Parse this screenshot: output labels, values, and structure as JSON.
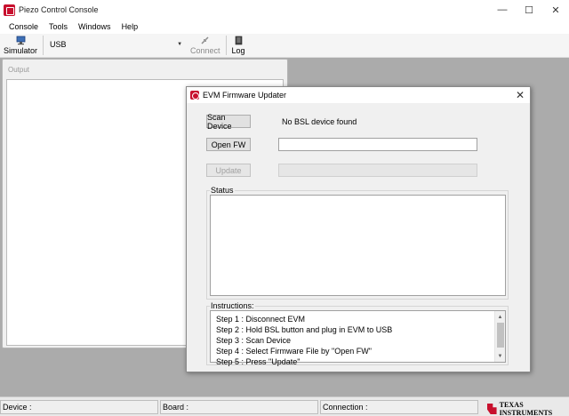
{
  "window": {
    "title": "Piezo Control Console",
    "controls": {
      "minimize": "—",
      "maximize": "☐",
      "close": "✕"
    }
  },
  "menu": [
    "Console",
    "Tools",
    "Windows",
    "Help"
  ],
  "toolbar": {
    "simulator_label": "Simulator",
    "connection_value": "USB",
    "connect_label": "Connect",
    "log_label": "Log"
  },
  "output": {
    "label": "Output"
  },
  "statusbar": {
    "device": "Device :",
    "board": "Board :",
    "connection": "Connection :",
    "brand": "Texas Instruments"
  },
  "dialog": {
    "title": "EVM Firmware Updater",
    "close": "✕",
    "scan_button": "Scan Device",
    "scan_status": "No BSL device found",
    "open_button": "Open FW",
    "firmware_path": "",
    "update_button": "Update",
    "status_label": "Status",
    "instructions_label": "Instructions:",
    "instructions": [
      "Step 1 : Disconnect EVM",
      "Step 2 : Hold BSL button and plug in EVM to USB",
      "Step 3 : Scan Device",
      "Step 4 : Select Firmware File by \"Open FW\"",
      "Step 5 : Press \"Update\""
    ]
  },
  "colors": {
    "brand_red": "#c8102e",
    "workspace_bg": "#ababab"
  }
}
